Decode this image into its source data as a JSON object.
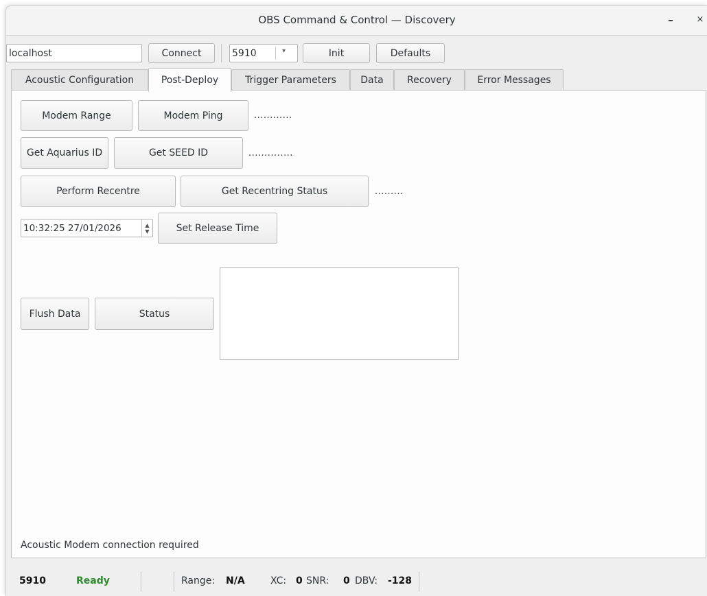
{
  "window": {
    "title": "OBS Command & Control — Discovery",
    "minimize": "–",
    "close": "×"
  },
  "toolbar": {
    "host_value": "localhost",
    "connect_label": "Connect",
    "port_value": "5910",
    "port_arrow": "▾",
    "init_label": "Init",
    "defaults_label": "Defaults"
  },
  "tabs": [
    {
      "label": "Acoustic Configuration"
    },
    {
      "label": "Post-Deploy"
    },
    {
      "label": "Trigger Parameters"
    },
    {
      "label": "Data"
    },
    {
      "label": "Recovery"
    },
    {
      "label": "Error Messages"
    }
  ],
  "post_deploy": {
    "modem_range_label": "Modem Range",
    "modem_ping_label": "Modem Ping",
    "range_dots": "............",
    "get_aquarius_label": "Get Aquarius ID",
    "get_seed_label": "Get SEED ID",
    "id_dots": "..............",
    "perform_recentre_label": "Perform Recentre",
    "get_recentring_label": "Get Recentring Status",
    "recentre_dots": ".........",
    "release_datetime": "10:32:25 27/01/2026",
    "set_release_label": "Set Release Time",
    "flush_label": "Flush Data",
    "status_label": "Status",
    "message": "Acoustic Modem connection required"
  },
  "statusbar": {
    "port": "5910",
    "state": "Ready",
    "state_color": "#2e8b2e",
    "range_label": "Range:",
    "range_value": "N/A",
    "xc_label": "XC:",
    "xc_value": "0",
    "snr_label": "SNR:",
    "snr_value": "0",
    "dbv_label": "DBV:",
    "dbv_value": "-128"
  }
}
